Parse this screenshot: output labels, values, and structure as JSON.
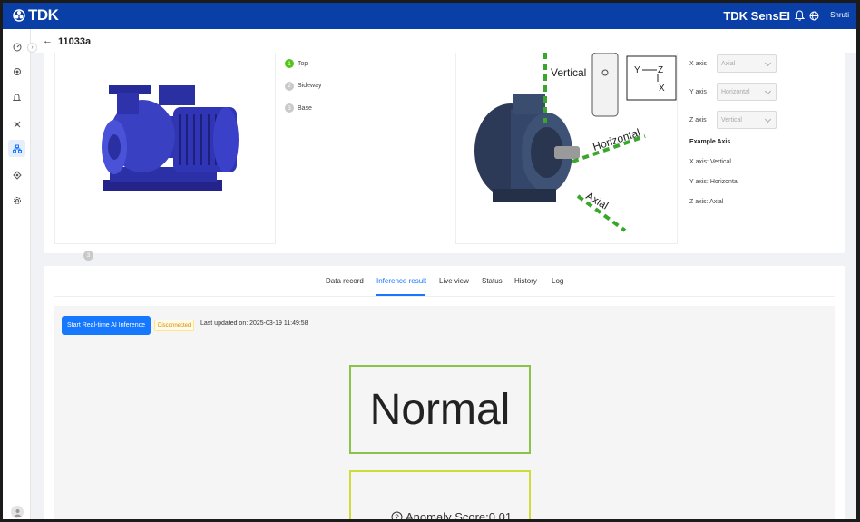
{
  "topbar": {
    "logo_text": "TDK",
    "brand": "TDK SensEI",
    "user_name": "Shruti"
  },
  "sidebar": {
    "items": [
      {
        "icon": "dashboard-icon"
      },
      {
        "icon": "sensor-icon"
      },
      {
        "icon": "alert-bell-icon"
      },
      {
        "icon": "model-icon"
      },
      {
        "icon": "hierarchy-icon",
        "active": true
      },
      {
        "icon": "network-icon"
      },
      {
        "icon": "settings-icon"
      }
    ]
  },
  "header": {
    "back_icon": "arrow-left-icon",
    "title": "11033a"
  },
  "setup": {
    "steps": [
      {
        "num": "1",
        "label": "Top"
      },
      {
        "num": "2",
        "label": "Sideway"
      },
      {
        "num": "3",
        "label": "Base"
      }
    ],
    "diagram_labels": {
      "vertical": "Vertical",
      "horizontal": "Horizontal",
      "axial": "Axial",
      "y": "Y",
      "z": "Z",
      "x": "X"
    },
    "axes": [
      {
        "label": "X axis",
        "value": "Axial"
      },
      {
        "label": "Y axis",
        "value": "Horizontal"
      },
      {
        "label": "Z axis",
        "value": "Vertical"
      }
    ],
    "example_title": "Example Axis",
    "example_lines": [
      "X axis: Vertical",
      "Y axis: Horizontal",
      "Z axis: Axial"
    ],
    "ghost_step": "3"
  },
  "tabs": [
    {
      "label": "Data record"
    },
    {
      "label": "Inference result",
      "active": true
    },
    {
      "label": "Live view"
    },
    {
      "label": "Status"
    },
    {
      "label": "History"
    },
    {
      "label": "Log"
    }
  ],
  "inference": {
    "start_button": "Start Real-time AI Inference",
    "status_tag": "Disconnected",
    "last_updated": "Last updated on: 2025-03-19 11:49:58",
    "result": "Normal",
    "anomaly_score": "Anomaly Score:0.01"
  },
  "colors": {
    "topbar": "#0a3fa8",
    "primary": "#1677ff",
    "normal_border": "#8bc34a",
    "score_border": "#cddc39",
    "axis_dash": "#3aa62b"
  }
}
